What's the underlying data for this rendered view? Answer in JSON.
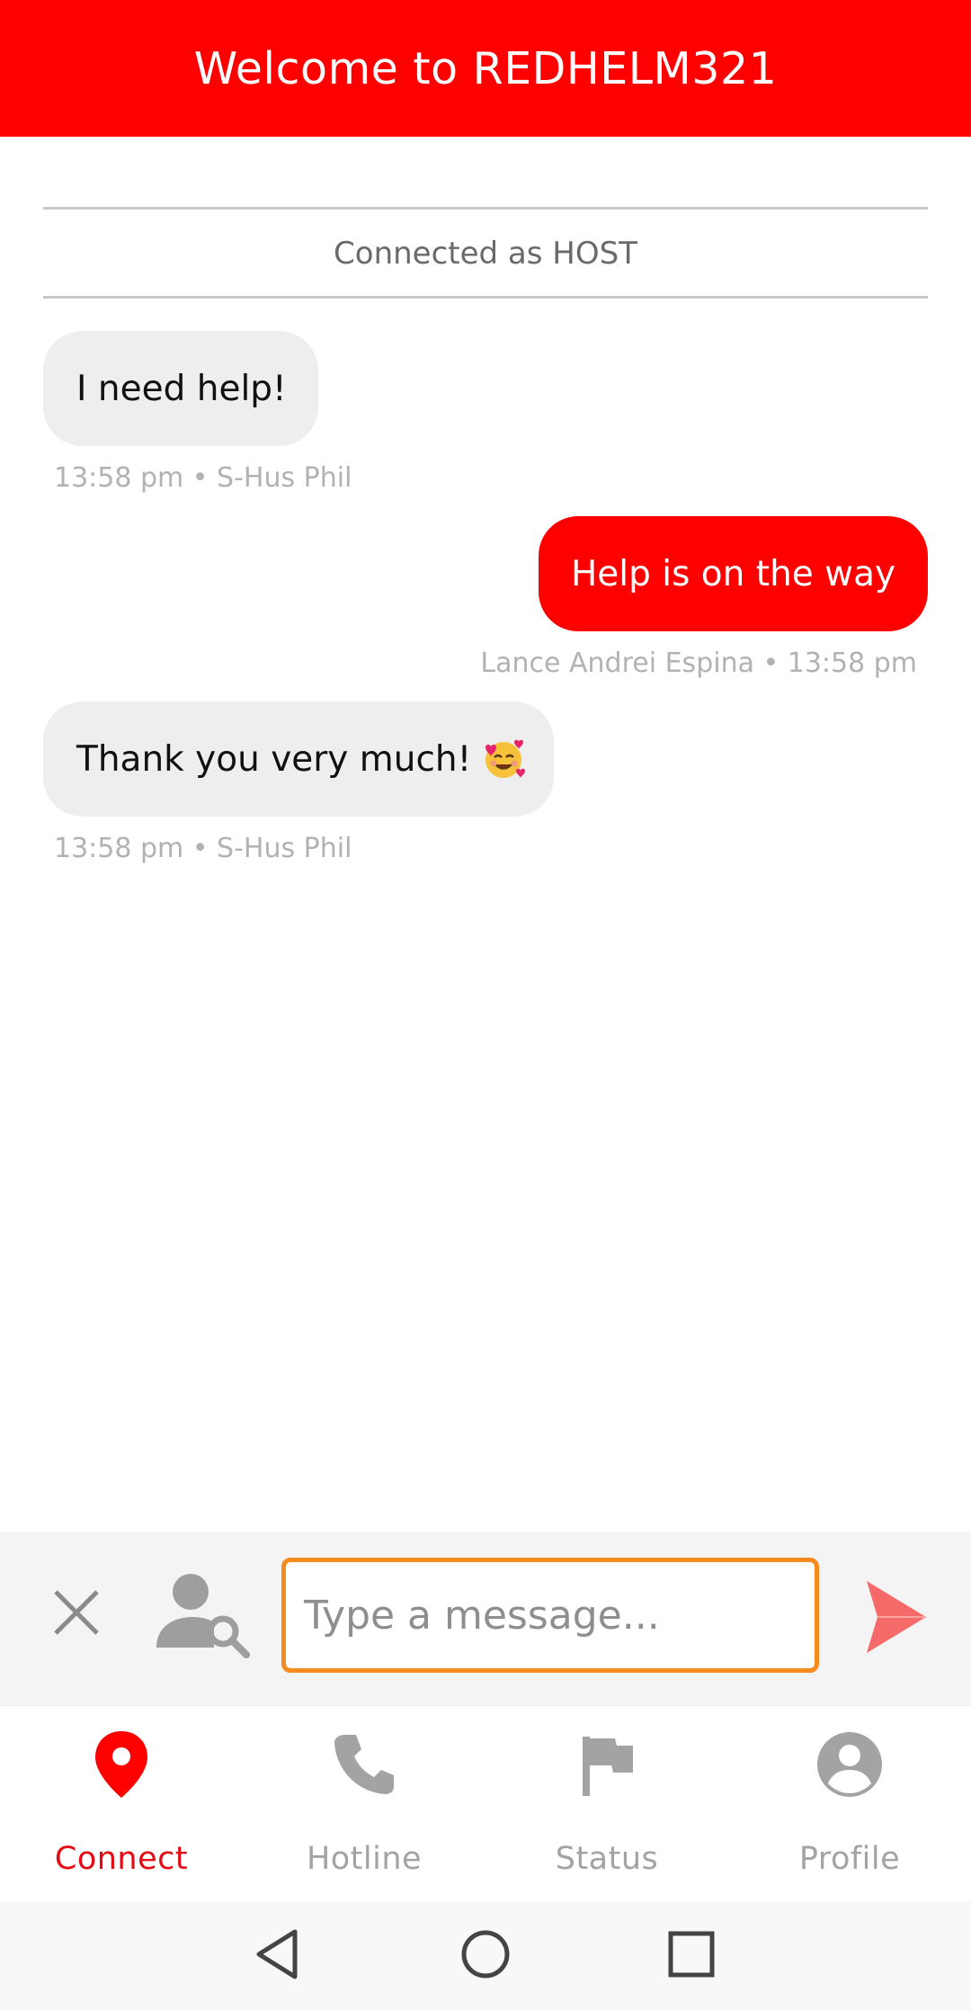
{
  "header": {
    "title": "Welcome to REDHELM321"
  },
  "connection": {
    "status": "Connected as HOST"
  },
  "messages": [
    {
      "direction": "incoming",
      "text": "I need help!",
      "meta": "13:58 pm • S-Hus Phil"
    },
    {
      "direction": "outgoing",
      "text": "Help is on the way",
      "meta": "Lance Andrei Espina • 13:58 pm"
    },
    {
      "direction": "incoming",
      "text": "Thank you very much!",
      "emoji": "smiling-face-with-hearts",
      "meta": "13:58 pm • S-Hus Phil"
    }
  ],
  "composer": {
    "placeholder": "Type a message...",
    "value": "",
    "icons": [
      "close-icon",
      "user-search-icon",
      "send-icon"
    ]
  },
  "nav": {
    "items": [
      {
        "label": "Connect",
        "icon": "location-pin-icon",
        "active": true
      },
      {
        "label": "Hotline",
        "icon": "phone-icon",
        "active": false
      },
      {
        "label": "Status",
        "icon": "flag-icon",
        "active": false
      },
      {
        "label": "Profile",
        "icon": "account-circle-icon",
        "active": false
      }
    ]
  },
  "system_nav": {
    "icons": [
      "back-icon",
      "home-icon",
      "recents-icon"
    ]
  },
  "colors": {
    "brand": "#ff0000",
    "active_nav": "#e50914",
    "input_border": "#f58a1f",
    "send": "#f76a6a",
    "inactive": "#a3a3a3"
  }
}
